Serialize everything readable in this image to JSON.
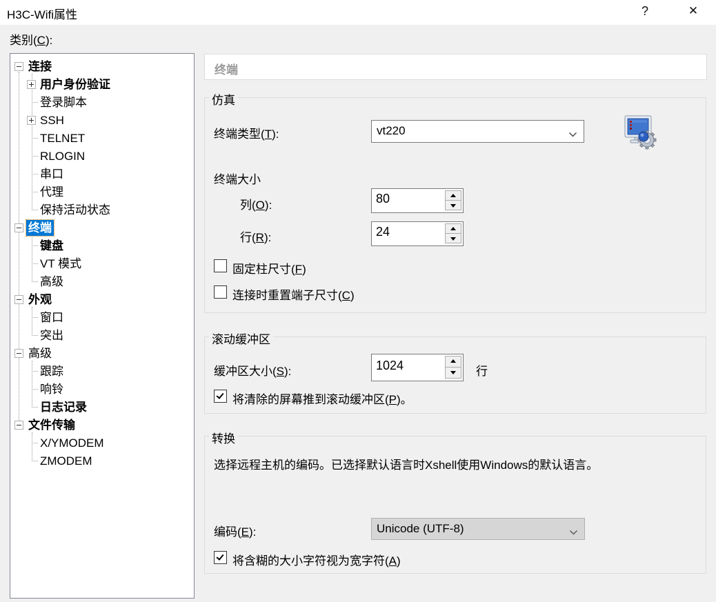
{
  "window": {
    "title": "H3C-Wifi属性",
    "help_label": "?",
    "close_label": "✕"
  },
  "category_label": {
    "pre": "类别(",
    "key": "C",
    "suf": "):"
  },
  "tree": {
    "items": [
      {
        "label": "连接",
        "level": 0,
        "expander": "minus",
        "bold": true,
        "selected": false
      },
      {
        "label": "用户身份验证",
        "level": 1,
        "expander": "plus",
        "bold": true,
        "selected": false
      },
      {
        "label": "登录脚本",
        "level": 1,
        "expander": null,
        "bold": false,
        "selected": false
      },
      {
        "label": "SSH",
        "level": 1,
        "expander": "plus",
        "bold": false,
        "selected": false
      },
      {
        "label": "TELNET",
        "level": 1,
        "expander": null,
        "bold": false,
        "selected": false
      },
      {
        "label": "RLOGIN",
        "level": 1,
        "expander": null,
        "bold": false,
        "selected": false
      },
      {
        "label": "串口",
        "level": 1,
        "expander": null,
        "bold": false,
        "selected": false
      },
      {
        "label": "代理",
        "level": 1,
        "expander": null,
        "bold": false,
        "selected": false
      },
      {
        "label": "保持活动状态",
        "level": 1,
        "expander": null,
        "bold": false,
        "selected": false
      },
      {
        "label": "终端",
        "level": 0,
        "expander": "minus",
        "bold": true,
        "selected": true
      },
      {
        "label": "键盘",
        "level": 1,
        "expander": null,
        "bold": true,
        "selected": false
      },
      {
        "label": "VT 模式",
        "level": 1,
        "expander": null,
        "bold": false,
        "selected": false
      },
      {
        "label": "高级",
        "level": 1,
        "expander": null,
        "bold": false,
        "selected": false
      },
      {
        "label": "外观",
        "level": 0,
        "expander": "minus",
        "bold": true,
        "selected": false
      },
      {
        "label": "窗口",
        "level": 1,
        "expander": null,
        "bold": false,
        "selected": false
      },
      {
        "label": "突出",
        "level": 1,
        "expander": null,
        "bold": false,
        "selected": false
      },
      {
        "label": "高级",
        "level": 0,
        "expander": "minus",
        "bold": false,
        "selected": false
      },
      {
        "label": "跟踪",
        "level": 1,
        "expander": null,
        "bold": false,
        "selected": false
      },
      {
        "label": "响铃",
        "level": 1,
        "expander": null,
        "bold": false,
        "selected": false
      },
      {
        "label": "日志记录",
        "level": 1,
        "expander": null,
        "bold": true,
        "selected": false
      },
      {
        "label": "文件传输",
        "level": 0,
        "expander": "minus",
        "bold": true,
        "selected": false
      },
      {
        "label": "X/YMODEM",
        "level": 1,
        "expander": null,
        "bold": false,
        "selected": false
      },
      {
        "label": "ZMODEM",
        "level": 1,
        "expander": null,
        "bold": false,
        "selected": false
      }
    ]
  },
  "panel": {
    "header": "终端",
    "emulation": {
      "legend": "仿真",
      "terminal_type_label": {
        "pre": "终端类型(",
        "key": "T",
        "suf": "):"
      },
      "terminal_type_value": "vt220",
      "terminal_size_label": "终端大小",
      "columns_label": {
        "pre": "列(",
        "key": "O",
        "suf": "):"
      },
      "columns_value": "80",
      "rows_label": {
        "pre": "行(",
        "key": "R",
        "suf": "):"
      },
      "rows_value": "24",
      "fixed_column_checkbox": {
        "pre": "固定柱尺寸(",
        "key": "F",
        "suf": ")",
        "checked": false
      },
      "reset_size_checkbox": {
        "pre": "连接时重置端子尺寸(",
        "key": "C",
        "suf": ")",
        "checked": false
      }
    },
    "scrollback": {
      "legend": "滚动缓冲区",
      "buffer_size_label": {
        "pre": "缓冲区大小(",
        "key": "S",
        "suf": "):"
      },
      "buffer_size_value": "1024",
      "buffer_unit": "行",
      "push_cleared_checkbox": {
        "pre": "将清除的屏幕推到滚动缓冲区(",
        "key": "P",
        "suf": ")。",
        "checked": true
      }
    },
    "translation": {
      "legend": "转换",
      "description": "选择远程主机的编码。已选择默认语言时Xshell使用Windows的默认语言。",
      "encoding_label": {
        "pre": "编码(",
        "key": "E",
        "suf": "):"
      },
      "encoding_value": "Unicode (UTF-8)",
      "ambiguous_checkbox": {
        "pre": "将含糊的大小字符视为宽字符(",
        "key": "A",
        "suf": ")",
        "checked": true
      }
    }
  },
  "colors": {
    "selection_blue": "#0078d7",
    "body_gray": "#f0f0f0",
    "groupbox_border": "#dcdcdc",
    "header_text_gray": "#9a9a9a",
    "combo_gray": "#d6d6d6"
  }
}
